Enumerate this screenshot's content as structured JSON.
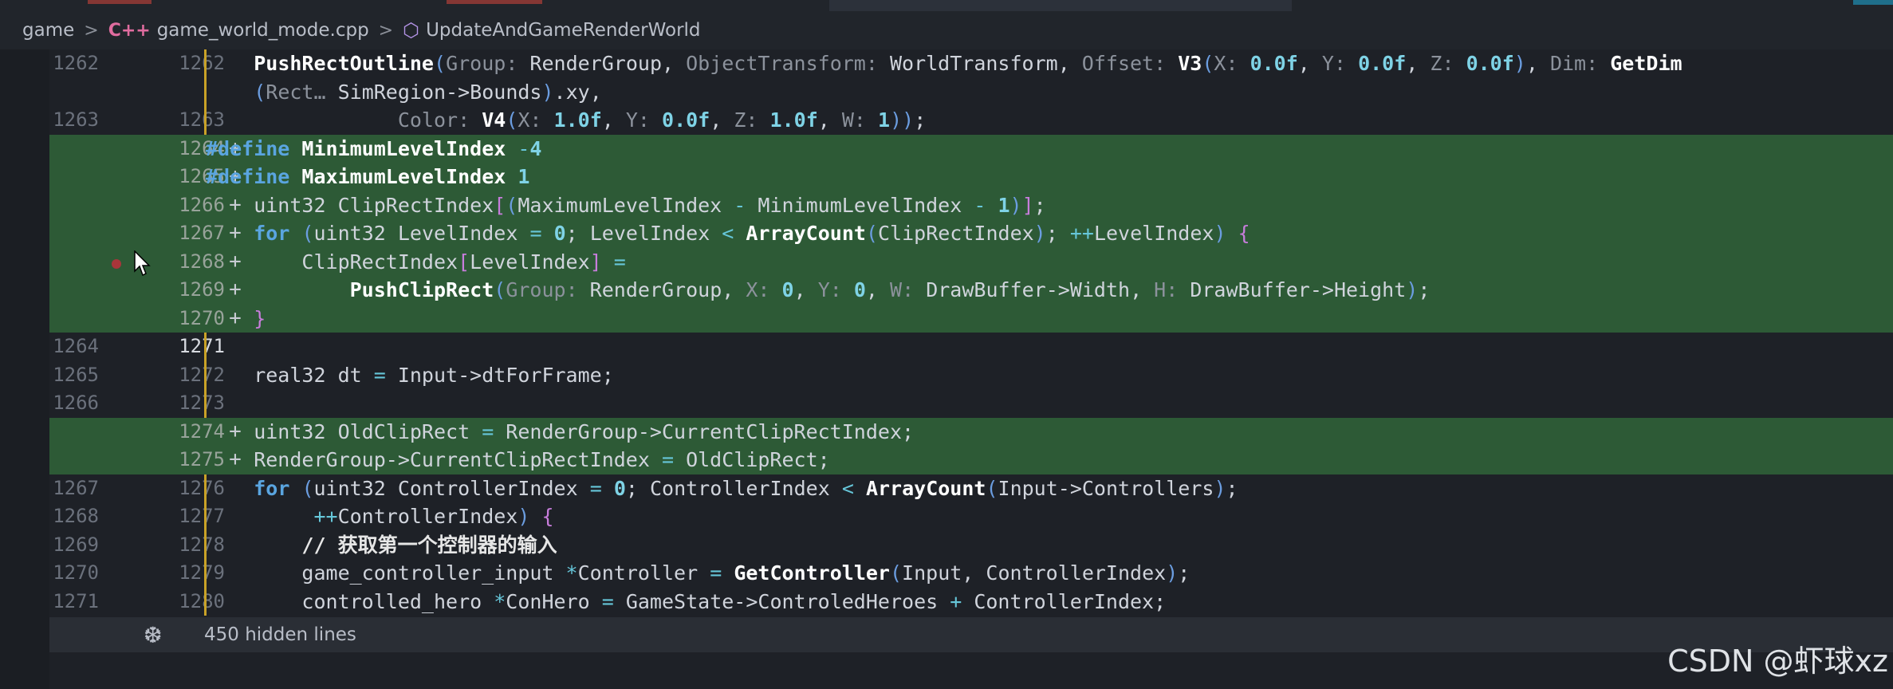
{
  "breadcrumb": {
    "folder": "game",
    "file": "game_world_mode.cpp",
    "symbol": "UpdateAndGameRenderWorld",
    "file_icon": "cpp-file-icon",
    "symbol_icon": "cube-icon"
  },
  "colors": {
    "added_line_bg": "#2d5a36",
    "editor_bg": "#1e2127",
    "keyword": "#5aa5e0",
    "number": "#7fd3e6",
    "modified_marker": "#c9a227",
    "breakpoint": "#a8353a"
  },
  "lines": [
    {
      "old": "1262",
      "new": "1262",
      "added": false,
      "segments": [
        [
          "",
          "    "
        ],
        [
          "fn",
          "PushRectOutline"
        ],
        [
          "paren",
          "("
        ],
        [
          "hint",
          "Group:"
        ],
        [
          "",
          " RenderGroup, "
        ],
        [
          "hint",
          "ObjectTransform:"
        ],
        [
          "",
          " WorldTransform, "
        ],
        [
          "hint",
          "Offset:"
        ],
        [
          "",
          " "
        ],
        [
          "fn",
          "V3"
        ],
        [
          "paren",
          "("
        ],
        [
          "hint",
          "X:"
        ],
        [
          "",
          " "
        ],
        [
          "num",
          "0.0f"
        ],
        [
          "",
          ", "
        ],
        [
          "hint",
          "Y:"
        ],
        [
          "",
          " "
        ],
        [
          "num",
          "0.0f"
        ],
        [
          "",
          ", "
        ],
        [
          "hint",
          "Z:"
        ],
        [
          "",
          " "
        ],
        [
          "num",
          "0.0f"
        ],
        [
          "paren",
          ")"
        ],
        [
          "",
          ", "
        ],
        [
          "hint",
          "Dim:"
        ],
        [
          "",
          " "
        ],
        [
          "fn",
          "GetDim"
        ]
      ]
    },
    {
      "old": "",
      "new": "",
      "added": false,
      "segments": [
        [
          "",
          "    "
        ],
        [
          "paren",
          "("
        ],
        [
          "hint",
          "Rect…"
        ],
        [
          "",
          " SimRegion->Bounds"
        ],
        [
          "paren",
          ")"
        ],
        [
          "",
          ".xy,"
        ]
      ]
    },
    {
      "old": "1263",
      "new": "1263",
      "added": false,
      "segments": [
        [
          "",
          "                "
        ],
        [
          "hint",
          "Color:"
        ],
        [
          "",
          " "
        ],
        [
          "fn",
          "V4"
        ],
        [
          "paren",
          "("
        ],
        [
          "hint",
          "X:"
        ],
        [
          "",
          " "
        ],
        [
          "num",
          "1.0f"
        ],
        [
          "",
          ", "
        ],
        [
          "hint",
          "Y:"
        ],
        [
          "",
          " "
        ],
        [
          "num",
          "0.0f"
        ],
        [
          "",
          ", "
        ],
        [
          "hint",
          "Z:"
        ],
        [
          "",
          " "
        ],
        [
          "num",
          "1.0f"
        ],
        [
          "",
          ", "
        ],
        [
          "hint",
          "W:"
        ],
        [
          "",
          " "
        ],
        [
          "num",
          "1"
        ],
        [
          "paren",
          "))"
        ],
        [
          "",
          ";"
        ]
      ]
    },
    {
      "old": "",
      "new": "1264",
      "added": true,
      "segments": [
        [
          "kw",
          "#define"
        ],
        [
          "",
          " "
        ],
        [
          "fn",
          "MinimumLevelIndex"
        ],
        [
          "",
          " "
        ],
        [
          "op",
          "-"
        ],
        [
          "num",
          "4"
        ]
      ]
    },
    {
      "old": "",
      "new": "1265",
      "added": true,
      "segments": [
        [
          "kw",
          "#define"
        ],
        [
          "",
          " "
        ],
        [
          "fn",
          "MaximumLevelIndex"
        ],
        [
          "",
          " "
        ],
        [
          "num",
          "1"
        ]
      ]
    },
    {
      "old": "",
      "new": "1266",
      "added": true,
      "segments": [
        [
          "",
          "    uint32 ClipRectIndex"
        ],
        [
          "paren2",
          "["
        ],
        [
          "paren",
          "("
        ],
        [
          "",
          "MaximumLevelIndex "
        ],
        [
          "op",
          "-"
        ],
        [
          "",
          " MinimumLevelIndex "
        ],
        [
          "op",
          "-"
        ],
        [
          "",
          " "
        ],
        [
          "num",
          "1"
        ],
        [
          "paren",
          ")"
        ],
        [
          "paren2",
          "]"
        ],
        [
          "",
          ";"
        ]
      ]
    },
    {
      "old": "",
      "new": "1267",
      "added": true,
      "segments": [
        [
          "",
          "    "
        ],
        [
          "kw",
          "for"
        ],
        [
          "",
          " "
        ],
        [
          "paren",
          "("
        ],
        [
          "",
          "uint32 LevelIndex "
        ],
        [
          "op",
          "="
        ],
        [
          "",
          " "
        ],
        [
          "num",
          "0"
        ],
        [
          "",
          "; LevelIndex "
        ],
        [
          "op",
          "<"
        ],
        [
          "",
          " "
        ],
        [
          "fn",
          "ArrayCount"
        ],
        [
          "paren",
          "("
        ],
        [
          "",
          "ClipRectIndex"
        ],
        [
          "paren",
          ")"
        ],
        [
          "",
          "; "
        ],
        [
          "op",
          "++"
        ],
        [
          "",
          "LevelIndex"
        ],
        [
          "paren",
          ")"
        ],
        [
          "",
          " "
        ],
        [
          "paren2",
          "{"
        ]
      ]
    },
    {
      "old": "",
      "new": "1268",
      "added": true,
      "segments": [
        [
          "",
          "        ClipRectIndex"
        ],
        [
          "paren2",
          "["
        ],
        [
          "",
          "LevelIndex"
        ],
        [
          "paren2",
          "]"
        ],
        [
          "",
          " "
        ],
        [
          "op",
          "="
        ]
      ]
    },
    {
      "old": "",
      "new": "1269",
      "added": true,
      "segments": [
        [
          "",
          "            "
        ],
        [
          "fn",
          "PushClipRect"
        ],
        [
          "paren",
          "("
        ],
        [
          "hint",
          "Group:"
        ],
        [
          "",
          " RenderGroup, "
        ],
        [
          "hint",
          "X:"
        ],
        [
          "",
          " "
        ],
        [
          "num",
          "0"
        ],
        [
          "",
          ", "
        ],
        [
          "hint",
          "Y:"
        ],
        [
          "",
          " "
        ],
        [
          "num",
          "0"
        ],
        [
          "",
          ", "
        ],
        [
          "hint",
          "W:"
        ],
        [
          "",
          " DrawBuffer->Width, "
        ],
        [
          "hint",
          "H:"
        ],
        [
          "",
          " DrawBuffer->Height"
        ],
        [
          "paren",
          ")"
        ],
        [
          "",
          ";"
        ]
      ]
    },
    {
      "old": "",
      "new": "1270",
      "added": true,
      "segments": [
        [
          "",
          "    "
        ],
        [
          "paren2",
          "}"
        ]
      ]
    },
    {
      "old": "1264",
      "new": "1271",
      "added": false,
      "current": true,
      "segments": []
    },
    {
      "old": "1265",
      "new": "1272",
      "added": false,
      "segments": [
        [
          "",
          "    real32 dt "
        ],
        [
          "op",
          "="
        ],
        [
          "",
          " Input->dtForFrame;"
        ]
      ]
    },
    {
      "old": "1266",
      "new": "1273",
      "added": false,
      "segments": []
    },
    {
      "old": "",
      "new": "1274",
      "added": true,
      "segments": [
        [
          "",
          "    uint32 OldClipRect "
        ],
        [
          "op",
          "="
        ],
        [
          "",
          " RenderGroup->CurrentClipRectIndex;"
        ]
      ]
    },
    {
      "old": "",
      "new": "1275",
      "added": true,
      "segments": [
        [
          "",
          "    RenderGroup->CurrentClipRectIndex "
        ],
        [
          "op",
          "="
        ],
        [
          "",
          " OldClipRect;"
        ]
      ]
    },
    {
      "old": "1267",
      "new": "1276",
      "added": false,
      "segments": [
        [
          "",
          "    "
        ],
        [
          "kw",
          "for"
        ],
        [
          "",
          " "
        ],
        [
          "paren",
          "("
        ],
        [
          "",
          "uint32 ControllerIndex "
        ],
        [
          "op",
          "="
        ],
        [
          "",
          " "
        ],
        [
          "num",
          "0"
        ],
        [
          "",
          "; ControllerIndex "
        ],
        [
          "op",
          "<"
        ],
        [
          "",
          " "
        ],
        [
          "fn",
          "ArrayCount"
        ],
        [
          "paren",
          "("
        ],
        [
          "",
          "Input->Controllers"
        ],
        [
          "paren",
          ")"
        ],
        [
          "",
          ";"
        ]
      ]
    },
    {
      "old": "1268",
      "new": "1277",
      "added": false,
      "segments": [
        [
          "",
          "         "
        ],
        [
          "op",
          "++"
        ],
        [
          "",
          "ControllerIndex"
        ],
        [
          "paren",
          ")"
        ],
        [
          "",
          " "
        ],
        [
          "paren2",
          "{"
        ]
      ]
    },
    {
      "old": "1269",
      "new": "1278",
      "added": false,
      "segments": [
        [
          "",
          "        "
        ],
        [
          "cm",
          "// 获取第一个控制器的输入"
        ]
      ]
    },
    {
      "old": "1270",
      "new": "1279",
      "added": false,
      "segments": [
        [
          "",
          "        game_controller_input "
        ],
        [
          "op",
          "*"
        ],
        [
          "",
          "Controller "
        ],
        [
          "op",
          "="
        ],
        [
          "",
          " "
        ],
        [
          "fn",
          "GetController"
        ],
        [
          "paren",
          "("
        ],
        [
          "",
          "Input, ControllerIndex"
        ],
        [
          "paren",
          ")"
        ],
        [
          "",
          ";"
        ]
      ]
    },
    {
      "old": "1271",
      "new": "1280",
      "added": false,
      "segments": [
        [
          "",
          "        controlled_hero "
        ],
        [
          "op",
          "*"
        ],
        [
          "",
          "ConHero "
        ],
        [
          "op",
          "="
        ],
        [
          "",
          " GameState->ControledHeroes "
        ],
        [
          "op",
          "+"
        ],
        [
          "",
          " ControllerIndex;"
        ]
      ]
    }
  ],
  "hidden": {
    "text": "450 hidden lines",
    "icon": "unfold-icon"
  },
  "watermark": "CSDN @虾球xz"
}
